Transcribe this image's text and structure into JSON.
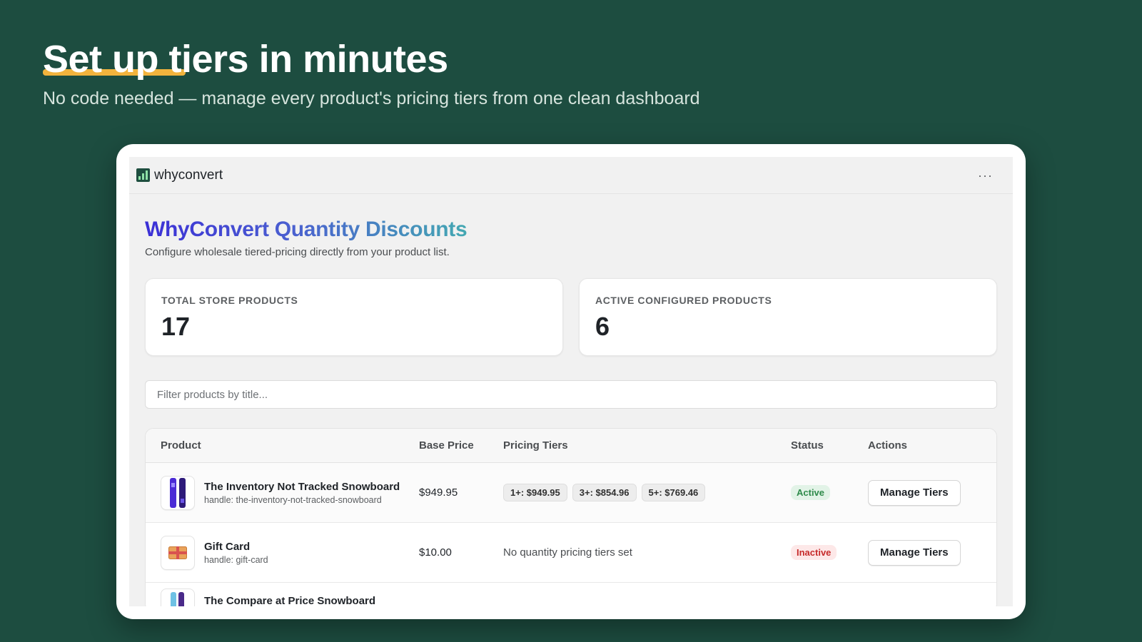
{
  "hero": {
    "title": "Set up tiers in minutes",
    "subtitle": "No code needed — manage every product's pricing tiers from one clean dashboard"
  },
  "app": {
    "brand": "whyconvert",
    "more_label": "···",
    "page_title": "WhyConvert Quantity Discounts",
    "page_description": "Configure wholesale tiered-pricing directly from your product list.",
    "stats": [
      {
        "label": "TOTAL STORE PRODUCTS",
        "value": "17"
      },
      {
        "label": "ACTIVE CONFIGURED PRODUCTS",
        "value": "6"
      }
    ],
    "filter": {
      "placeholder": "Filter products by title...",
      "value": ""
    },
    "table": {
      "headers": [
        "Product",
        "Base Price",
        "Pricing Tiers",
        "Status",
        "Actions"
      ],
      "rows": [
        {
          "title": "The Inventory Not Tracked Snowboard",
          "handle": "handle: the-inventory-not-tracked-snowboard",
          "price": "$949.95",
          "tiers": [
            "1+: $949.95",
            "3+: $854.96",
            "5+: $769.46"
          ],
          "tiers_empty": "",
          "status": "Active",
          "action": "Manage Tiers"
        },
        {
          "title": "Gift Card",
          "handle": "handle: gift-card",
          "price": "$10.00",
          "tiers": [],
          "tiers_empty": "No quantity pricing tiers set",
          "status": "Inactive",
          "action": "Manage Tiers"
        },
        {
          "title": "The Compare at Price Snowboard",
          "handle": "",
          "price": "",
          "tiers": [],
          "tiers_empty": "",
          "status": "",
          "action": ""
        }
      ]
    }
  },
  "colors": {
    "background": "#1d4d40",
    "accent_underline": "#f2b33d",
    "active": "#2e8a4a",
    "inactive": "#c62a2a"
  }
}
